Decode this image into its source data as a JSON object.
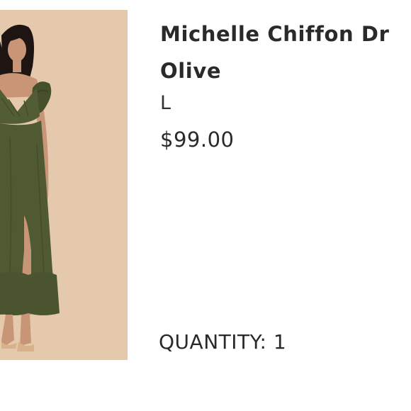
{
  "product": {
    "name_line1": "Michelle Chiffon Dr",
    "name_line2": "Olive",
    "size": "L",
    "price": "$99.00",
    "quantity_label": "QUANTITY: 1"
  },
  "image": {
    "kind": "product-photo",
    "subject": "model-wearing-olive-dress",
    "colors": {
      "background": "#e5c9ad",
      "dress": "#4f5a33",
      "skin": "#c99577",
      "hair": "#1e1411",
      "shoes": "#d8b08c"
    }
  }
}
